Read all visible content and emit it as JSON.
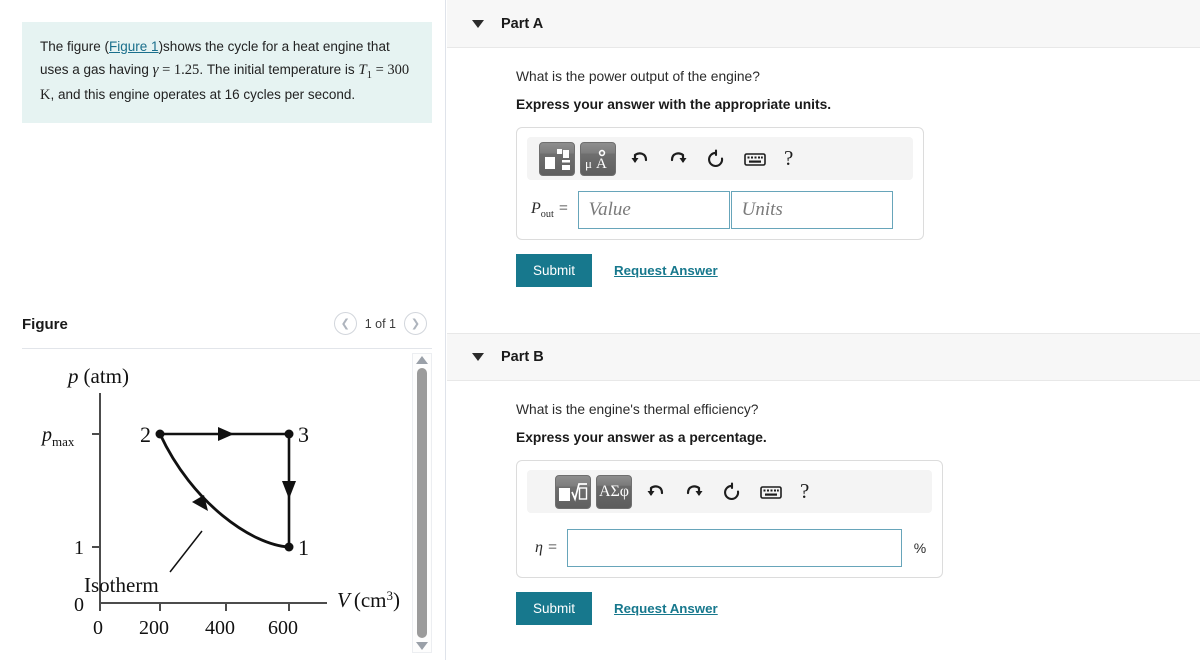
{
  "problem": {
    "text_part1": "The figure (",
    "figure_link": "Figure 1",
    "text_part2": ")shows the cycle for a heat engine that uses a gas having ",
    "gamma_symbol": "γ",
    "gamma_eq": " = 1.25",
    "text_part3": ". The initial temperature is ",
    "t1_symbol": "T",
    "t1_sub": "1",
    "t1_value": " = 300 K",
    "text_part4": ", and this engine operates at 16 cycles per second."
  },
  "figure": {
    "title": "Figure",
    "counter": "1 of 1",
    "prev_icon": "chevron-left-icon",
    "next_icon": "chevron-right-icon",
    "scroll_up_icon": "scroll-up-arrow-icon",
    "scroll_down_icon": "scroll-down-arrow-icon"
  },
  "chart_data": {
    "type": "line",
    "title": "",
    "xlabel": "V (cm³)",
    "ylabel": "p (atm)",
    "xlim": [
      0,
      700
    ],
    "ylim": [
      0,
      2.6
    ],
    "grid": false,
    "x_ticks": [
      0,
      200,
      400,
      600
    ],
    "x_tick_labels": [
      "0",
      "200",
      "400",
      "600"
    ],
    "y_ticks": [
      0,
      1,
      2
    ],
    "y_tick_labels": [
      "0",
      "1",
      "p_max"
    ],
    "y_tick_label_pmax": "p",
    "y_tick_label_pmax_sub": "max",
    "points": [
      {
        "label": "1",
        "V": 600,
        "p": 1.0
      },
      {
        "label": "2",
        "V": 200,
        "p": 2.0
      },
      {
        "label": "3",
        "V": 600,
        "p": 2.0
      }
    ],
    "processes": [
      {
        "from": "2",
        "to": "3",
        "kind": "isobaric",
        "arrow": "right"
      },
      {
        "from": "3",
        "to": "1",
        "kind": "isochoric",
        "arrow": "down"
      },
      {
        "from": "1",
        "to": "2",
        "kind": "isothermal",
        "arrow": "up-left"
      }
    ],
    "annotations": [
      {
        "text": "Isotherm",
        "points_to": "process-1-to-2"
      }
    ],
    "axis_label_x": "V",
    "axis_label_x_unit": "(cm",
    "axis_label_x_exp": "3",
    "axis_label_x_close": ")",
    "axis_label_y": "p",
    "axis_label_y_unit": "(atm)"
  },
  "parts": [
    {
      "id": "a",
      "label": "Part A",
      "caret_icon": "caret-down-icon",
      "question": "What is the power output of the engine?",
      "instruction": "Express your answer with the appropriate units.",
      "toolbar": [
        {
          "name": "template-matrix-button",
          "glyph": "template"
        },
        {
          "name": "units-button",
          "glyph": "units"
        },
        {
          "name": "undo-icon",
          "glyph": "undo"
        },
        {
          "name": "redo-icon",
          "glyph": "redo"
        },
        {
          "name": "reset-icon",
          "glyph": "reset"
        },
        {
          "name": "keyboard-icon",
          "glyph": "keyboard"
        },
        {
          "name": "help-icon",
          "glyph": "?"
        }
      ],
      "variable": "P",
      "variable_sub": "out",
      "variable_eq": "=",
      "value_placeholder": "Value",
      "value_text": "",
      "units_placeholder": "Units",
      "units_text": "",
      "submit_label": "Submit",
      "request_label": "Request Answer"
    },
    {
      "id": "b",
      "label": "Part B",
      "caret_icon": "caret-down-icon",
      "question": "What is the engine's thermal efficiency?",
      "instruction": "Express your answer as a percentage.",
      "toolbar": [
        {
          "name": "nth-root-button",
          "glyph": "root"
        },
        {
          "name": "greek-letters-button",
          "glyph": "ΑΣφ"
        },
        {
          "name": "undo-icon",
          "glyph": "undo"
        },
        {
          "name": "redo-icon",
          "glyph": "redo"
        },
        {
          "name": "reset-icon",
          "glyph": "reset"
        },
        {
          "name": "keyboard-icon",
          "glyph": "keyboard"
        },
        {
          "name": "help-icon",
          "glyph": "?"
        }
      ],
      "variable": "η",
      "variable_sub": "",
      "variable_eq": "=",
      "value_placeholder": "",
      "value_text": "",
      "percent_label": "%",
      "submit_label": "Submit",
      "request_label": "Request Answer"
    }
  ],
  "colors": {
    "accent": "#17788d",
    "problem_bg": "#e6f3f2",
    "input_border": "#67a5ba",
    "part_header_bg": "#f7f7f7"
  }
}
